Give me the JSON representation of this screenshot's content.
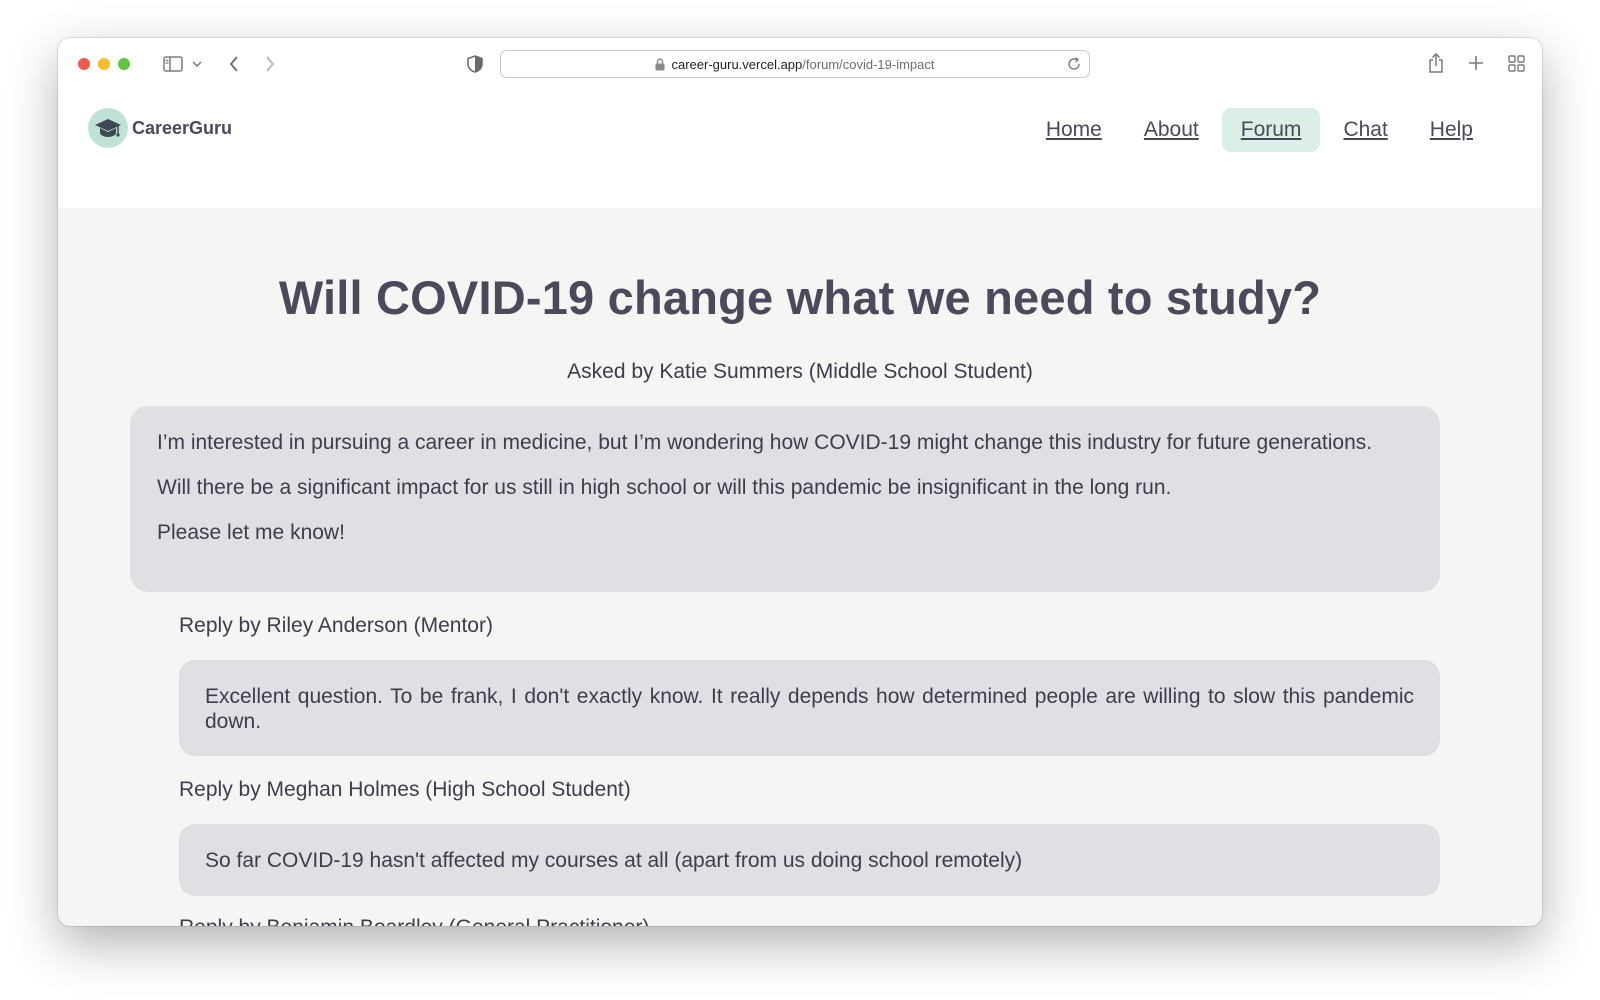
{
  "browser": {
    "url_domain": "career-guru.vercel.app",
    "url_path": "/forum/covid-19-impact"
  },
  "header": {
    "logo_text": "CareerGuru",
    "nav": [
      {
        "label": "Home"
      },
      {
        "label": "About"
      },
      {
        "label": "Forum",
        "active": true
      },
      {
        "label": "Chat"
      },
      {
        "label": "Help"
      }
    ]
  },
  "question": {
    "title": "Will COVID-19 change what we need to study?",
    "asked_by": "Asked by Katie Summers (Middle School Student)",
    "paragraphs": [
      "I’m interested in pursuing a career in medicine, but I’m wondering how COVID-19 might change this industry for future generations.",
      "Will there be a significant impact for us still in high school or will this pandemic be insignificant in the long run.",
      "Please let me know!"
    ]
  },
  "replies": [
    {
      "by": "Reply by Riley Anderson (Mentor)",
      "text": "Excellent question. To be frank, I don't exactly know. It really depends how determined people are willing to slow this pandemic down."
    },
    {
      "by": "Reply by Meghan Holmes (High School Student)",
      "text": "So far COVID-19 hasn't affected my courses at all (apart from us doing school remotely)"
    },
    {
      "by": "Reply by Benjamin Boardley (General Practitioner)"
    }
  ],
  "colors": {
    "text": "#4a4a5c",
    "card": "#e0dfe4",
    "page_bg": "#f6f5f4",
    "nav_active": "#dcefe6",
    "logo_badge": "#bfe2d5"
  },
  "icons": [
    "sidebar-icon",
    "chevron-down-icon",
    "back-icon",
    "forward-icon",
    "shield-icon",
    "lock-icon",
    "reload-icon",
    "share-icon",
    "plus-icon",
    "tabs-grid-icon",
    "graduation-cap-icon"
  ]
}
